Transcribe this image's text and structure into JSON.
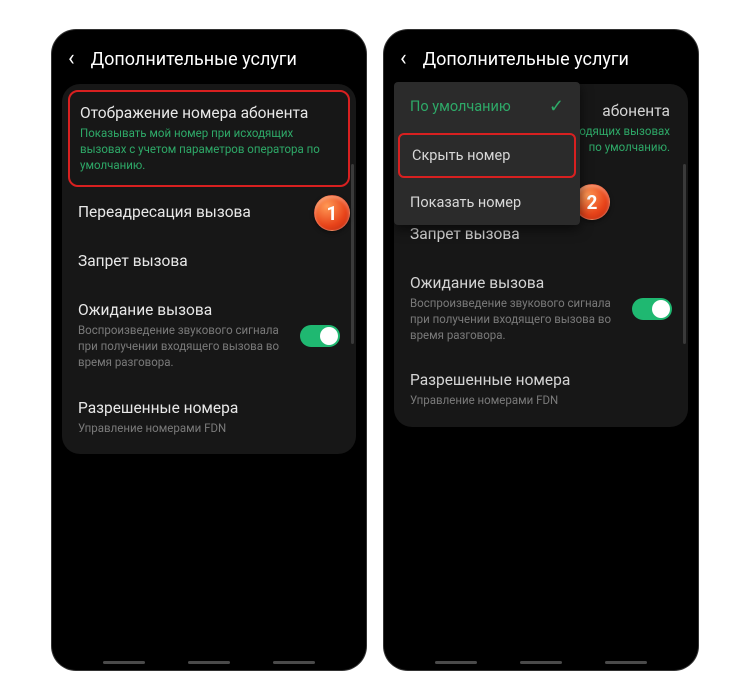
{
  "screens": {
    "left": {
      "title": "Дополнительные услуги",
      "badge": "1",
      "items": {
        "caller_id": {
          "title": "Отображение номера абонента",
          "desc": "Показывать мой номер при исходящих вызовах с учетом параметров оператора по умолчанию."
        },
        "forward": {
          "title": "Переадресация вызова"
        },
        "barring": {
          "title": "Запрет вызова"
        },
        "waiting": {
          "title": "Ожидание вызова",
          "desc": "Воспроизведение звукового сигнала при получении входящего вызова во время разговора."
        },
        "fdn": {
          "title": "Разрешенные номера",
          "desc": "Управление номерами FDN"
        }
      }
    },
    "right": {
      "title": "Дополнительные услуги",
      "badge": "2",
      "popup": {
        "default": "По умолчанию",
        "hide": "Скрыть номер",
        "show": "Показать номер"
      },
      "items": {
        "caller_id_tail": "абонента",
        "caller_id_desc1": "ходящих вызовах",
        "caller_id_desc2": "по умолчанию.",
        "barring": {
          "title": "Запрет вызова"
        },
        "waiting": {
          "title": "Ожидание вызова",
          "desc": "Воспроизведение звукового сигнала при получении входящего вызова во время разговора."
        },
        "fdn": {
          "title": "Разрешенные номера",
          "desc": "Управление номерами FDN"
        }
      }
    }
  }
}
